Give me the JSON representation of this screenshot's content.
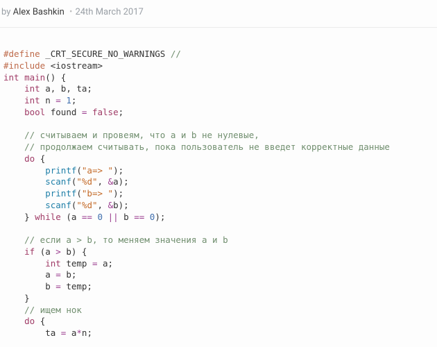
{
  "header": {
    "by": "by",
    "author": "Alex Bashkin",
    "date": "24th March 2017"
  },
  "code": {
    "l1": {
      "a": "#define",
      "b": " _CRT_SECURE_NO_WARNINGS ",
      "c": "//"
    },
    "l2": {
      "a": "#include",
      "b": " ",
      "c": "<iostream>"
    },
    "l3": {
      "a": "int",
      "b": " ",
      "c": "main",
      "d": "()",
      "e": " {"
    },
    "l4": {
      "a": "    ",
      "b": "int",
      "c": " a, b, ta;"
    },
    "l5": {
      "a": "    ",
      "b": "int",
      "c": " n ",
      "d": "=",
      "e": " ",
      "f": "1",
      "g": ";"
    },
    "l6": {
      "a": "    ",
      "b": "bool",
      "c": " found ",
      "d": "=",
      "e": " ",
      "f": "false",
      "g": ";"
    },
    "l7": "",
    "l8": {
      "a": "    ",
      "b": "// считываем и провеям, что a и b не нулевые,"
    },
    "l9": {
      "a": "    ",
      "b": "// продолжаем считывать, пока пользователь не введет корректные данные"
    },
    "l10": {
      "a": "    ",
      "b": "do",
      "c": " {"
    },
    "l11": {
      "a": "        ",
      "b": "printf",
      "c": "(",
      "d": "\"a=> \"",
      "e": ");"
    },
    "l12": {
      "a": "        ",
      "b": "scanf",
      "c": "(",
      "d": "\"%d\"",
      "e": ", ",
      "f": "&",
      "g": "a);"
    },
    "l13": {
      "a": "        ",
      "b": "printf",
      "c": "(",
      "d": "\"b=> \"",
      "e": ");"
    },
    "l14": {
      "a": "        ",
      "b": "scanf",
      "c": "(",
      "d": "\"%d\"",
      "e": ", ",
      "f": "&",
      "g": "b);"
    },
    "l15": {
      "a": "    } ",
      "b": "while",
      "c": " (a ",
      "d": "==",
      "e": " ",
      "f": "0",
      "g": " ",
      "h": "||",
      "i": " b ",
      "j": "==",
      "k": " ",
      "l": "0",
      "m": ");"
    },
    "l16": "",
    "l17": {
      "a": "    ",
      "b": "// если a > b, то меняем значения a и b"
    },
    "l18": {
      "a": "    ",
      "b": "if",
      "c": " (a ",
      "d": ">",
      "e": " b) {"
    },
    "l19": {
      "a": "        ",
      "b": "int",
      "c": " temp ",
      "d": "=",
      "e": " a;"
    },
    "l20": {
      "a": "        a ",
      "b": "=",
      "c": " b;"
    },
    "l21": {
      "a": "        b ",
      "b": "=",
      "c": " temp;"
    },
    "l22": "    }",
    "l23": {
      "a": "    ",
      "b": "// ищем нок"
    },
    "l24": {
      "a": "    ",
      "b": "do",
      "c": " {"
    },
    "l25": {
      "a": "        ta ",
      "b": "=",
      "c": " a",
      "d": "*",
      "e": "n;"
    }
  }
}
